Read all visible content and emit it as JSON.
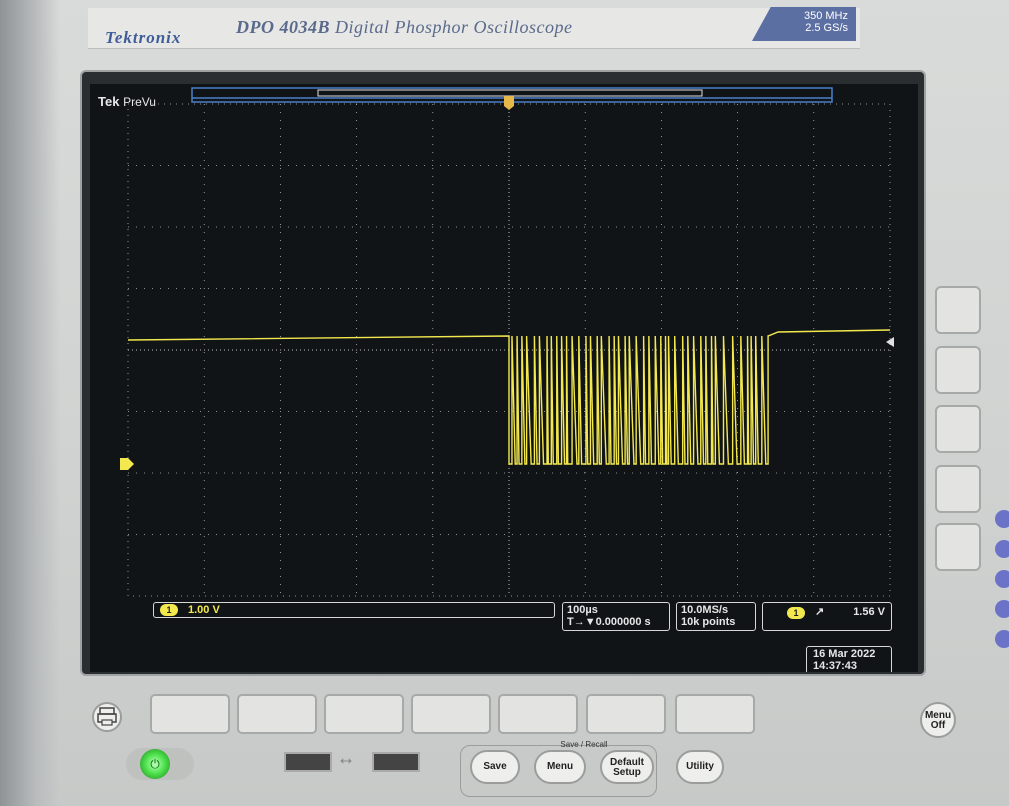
{
  "header": {
    "brand": "Tektronix",
    "model_bold": "DPO 4034B",
    "model_rest": " Digital Phosphor Oscilloscope",
    "spec_bandwidth": "350 MHz",
    "spec_rate": "2.5 GS/s"
  },
  "screen": {
    "tek": "Tek",
    "mode": "PreVu",
    "ch1_badge": "1",
    "ch1_scale": "1.00 V",
    "timebase": "100µs",
    "trigger_position": "T→▼0.000000 s",
    "sample_rate": "10.0MS/s",
    "record_length": "10k points",
    "trigger_channel": "1",
    "trigger_slope": "↗",
    "trigger_level": "1.56 V",
    "date": "16 Mar 2022",
    "time": "14:37:43",
    "trace_color": "#f3e94e",
    "grid_color": "#b8b8b8",
    "marker_color": "#e6b84a"
  },
  "controls": {
    "save": "Save",
    "menu": "Menu",
    "default_setup_line1": "Default",
    "default_setup_line2": "Setup",
    "utility": "Utility",
    "save_recall": "Save / Recall",
    "menu_off_line1": "Menu",
    "menu_off_line2": "Off",
    "power_icon": "power-icon",
    "print_icon": "print-icon",
    "usb_icon": "usb-icon"
  }
}
